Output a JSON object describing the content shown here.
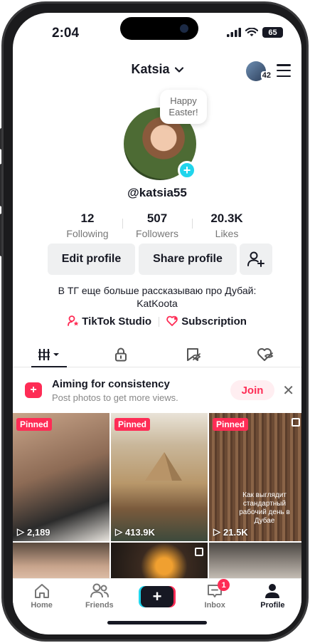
{
  "status": {
    "time": "2:04",
    "battery": "65"
  },
  "header": {
    "username": "Katsia",
    "story_count": "42"
  },
  "profile": {
    "bubble_text": "Happy Easter!",
    "handle": "@katsia55",
    "stats": [
      {
        "value": "12",
        "label": "Following"
      },
      {
        "value": "507",
        "label": "Followers"
      },
      {
        "value": "20.3K",
        "label": "Likes"
      }
    ],
    "edit_profile": "Edit profile",
    "share_profile": "Share profile",
    "bio_line1": "В ТГ еще больше рассказываю про Дубай:",
    "bio_line2": "KatKoota",
    "studio_link": "TikTok Studio",
    "subscription_link": "Subscription"
  },
  "banner": {
    "title": "Aiming for consistency",
    "subtitle": "Post photos to get more views.",
    "join_label": "Join"
  },
  "videos": [
    {
      "pinned": "Pinned",
      "views": "2,189",
      "caption": ""
    },
    {
      "pinned": "Pinned",
      "views": "413.9K",
      "caption": ""
    },
    {
      "pinned": "Pinned",
      "views": "21.5K",
      "caption": "Как выглядит стандартный рабочий день в Дубае"
    }
  ],
  "nav": {
    "home": "Home",
    "friends": "Friends",
    "inbox": "Inbox",
    "inbox_badge": "1",
    "profile": "Profile"
  },
  "colors": {
    "accent": "#fe2c55",
    "cyan": "#20d5ec",
    "text": "#161823"
  }
}
